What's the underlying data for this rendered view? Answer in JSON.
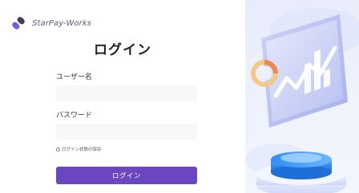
{
  "brand": {
    "name": "StarPay-Works"
  },
  "login": {
    "title": "ログイン",
    "username_label": "ユーザー名",
    "username_value": "",
    "password_label": "パスワード",
    "password_value": "",
    "remember_label": "ログイン状態の保存",
    "remember_checked": false,
    "submit_label": "ログイン"
  },
  "colors": {
    "accent": "#6b46c1",
    "input_bg": "#f6f7f9",
    "illustration_bg": "#eef1fb"
  }
}
